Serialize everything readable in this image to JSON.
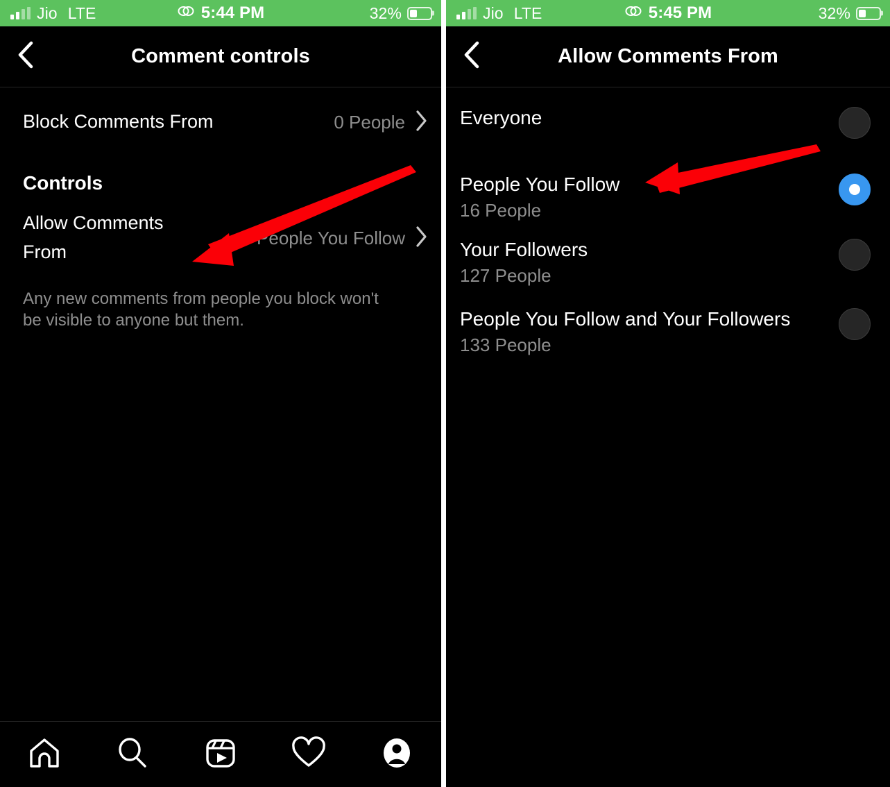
{
  "left_screen": {
    "status_bar": {
      "carrier": "Jio",
      "network": "LTE",
      "time": "5:44 PM",
      "battery_percent": "32%",
      "battery_level": 32,
      "signal_icon": "signal-bars-icon",
      "link_icon": "chain-link-icon",
      "background_color": "#5cc25e"
    },
    "nav": {
      "back_icon": "chevron-left-icon",
      "title": "Comment controls"
    },
    "block_row": {
      "label": "Block Comments From",
      "value": "0 People",
      "chevron_icon": "chevron-right-icon"
    },
    "section_header": "Controls",
    "allow_row": {
      "label": "Allow Comments From",
      "value": "People You Follow",
      "chevron_icon": "chevron-right-icon"
    },
    "footnote": "Any new comments from people you block won't be visible to anyone but them.",
    "tabbar": [
      {
        "name": "home-icon",
        "label": "Home"
      },
      {
        "name": "search-icon",
        "label": "Search"
      },
      {
        "name": "reels-icon",
        "label": "Reels"
      },
      {
        "name": "heart-icon",
        "label": "Activity"
      },
      {
        "name": "profile-icon",
        "label": "Profile"
      }
    ]
  },
  "right_screen": {
    "status_bar": {
      "carrier": "Jio",
      "network": "LTE",
      "time": "5:45 PM",
      "battery_percent": "32%",
      "battery_level": 32,
      "signal_icon": "signal-bars-icon",
      "link_icon": "chain-link-icon",
      "background_color": "#5cc25e"
    },
    "nav": {
      "back_icon": "chevron-left-icon",
      "title": "Allow Comments From"
    },
    "options": [
      {
        "title": "Everyone",
        "subtitle": "",
        "selected": false
      },
      {
        "title": "People You Follow",
        "subtitle": "16 People",
        "selected": true
      },
      {
        "title": "Your Followers",
        "subtitle": "127 People",
        "selected": false
      },
      {
        "title": "People You Follow and Your Followers",
        "subtitle": "133 People",
        "selected": false
      }
    ]
  },
  "annotations": {
    "arrow_color": "#fb0007",
    "left_arrow_target": "Allow Comments From",
    "right_arrow_target": "People You Follow"
  }
}
